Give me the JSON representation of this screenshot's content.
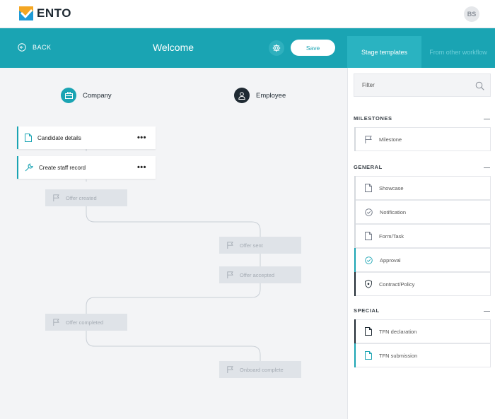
{
  "app": {
    "logo_text": "ENTO",
    "user_initials": "BS"
  },
  "header": {
    "back_label": "BACK",
    "title": "Welcome",
    "save_label": "Save"
  },
  "tabs": [
    {
      "label": "Stage templates",
      "active": true
    },
    {
      "label": "From other workflow",
      "active": false
    }
  ],
  "lanes": [
    {
      "label": "Company",
      "icon": "briefcase-icon"
    },
    {
      "label": "Employee",
      "icon": "user-icon"
    }
  ],
  "stages": [
    {
      "label": "Candidate details",
      "icon": "document-icon"
    },
    {
      "label": "Create staff record",
      "icon": "wrench-icon"
    }
  ],
  "placeholders": [
    {
      "label": "Offer created",
      "icon": "flag-icon"
    },
    {
      "label": "Offer sent",
      "icon": "flag-icon"
    },
    {
      "label": "Offer accepted",
      "icon": "flag-icon"
    },
    {
      "label": "Offer completed",
      "icon": "flag-icon"
    },
    {
      "label": "Onboard complete",
      "icon": "flag-icon"
    }
  ],
  "panel": {
    "filter_placeholder": "Filter",
    "sections": [
      {
        "title": "MILESTONES",
        "items": [
          {
            "label": "Milestone",
            "icon": "flag-icon"
          }
        ]
      },
      {
        "title": "GENERAL",
        "items": [
          {
            "label": "Showcase",
            "icon": "document-icon"
          },
          {
            "label": "Notification",
            "icon": "check-circle-icon"
          },
          {
            "label": "Form/Task",
            "icon": "document-icon"
          },
          {
            "label": "Approval",
            "icon": "check-circle-icon"
          },
          {
            "label": "Contract/Policy",
            "icon": "shield-icon"
          }
        ]
      },
      {
        "title": "SPECIAL",
        "items": [
          {
            "label": "TFN declaration",
            "icon": "document-icon"
          },
          {
            "label": "TFN submission",
            "icon": "document-icon"
          }
        ]
      }
    ]
  },
  "colors": {
    "accent": "#1aa4b3",
    "dark": "#1f2a33",
    "ghost": "#dfe3e8",
    "canvas": "#f3f4f6"
  }
}
